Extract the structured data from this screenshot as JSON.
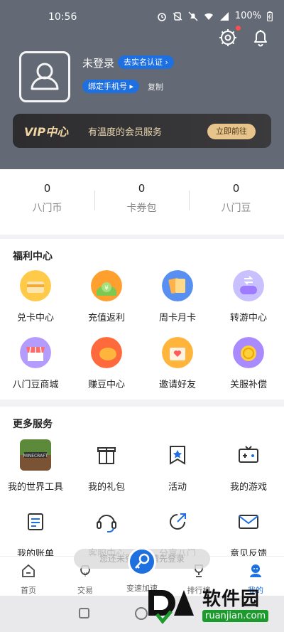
{
  "status_bar": {
    "time": "10:56",
    "battery": "100%"
  },
  "profile": {
    "username": "未登录",
    "verify_label": "去实名认证",
    "bind_phone_label": "绑定手机号",
    "copy_label": "复制"
  },
  "vip": {
    "title": "VIP中心",
    "subtitle": "有温度的会员服务",
    "button": "立即前往"
  },
  "stats": [
    {
      "value": "0",
      "label": "八门币"
    },
    {
      "value": "0",
      "label": "卡券包"
    },
    {
      "value": "0",
      "label": "八门豆"
    }
  ],
  "welfare": {
    "title": "福利中心",
    "items": [
      {
        "label": "兑卡中心",
        "icon": "card-stack-icon"
      },
      {
        "label": "充值返利",
        "icon": "money-bag-icon"
      },
      {
        "label": "周卡月卡",
        "icon": "cards-icon"
      },
      {
        "label": "转游中心",
        "icon": "gamepad-transfer-icon"
      },
      {
        "label": "八门豆商城",
        "icon": "shop-icon"
      },
      {
        "label": "赚豆中心",
        "icon": "bean-icon"
      },
      {
        "label": "邀请好友",
        "icon": "invite-envelope-icon"
      },
      {
        "label": "关服补偿",
        "icon": "coin-icon"
      }
    ]
  },
  "services": {
    "title": "更多服务",
    "items": [
      {
        "label": "我的世界工具",
        "icon": "minecraft-icon"
      },
      {
        "label": "我的礼包",
        "icon": "gift-icon"
      },
      {
        "label": "活动",
        "icon": "star-flag-icon"
      },
      {
        "label": "我的游戏",
        "icon": "game-console-icon"
      },
      {
        "label": "我的账单",
        "icon": "bill-icon"
      },
      {
        "label": "客服中心",
        "icon": "headset-icon"
      },
      {
        "label": "分享八门",
        "icon": "share-icon"
      },
      {
        "label": "意见反馈",
        "icon": "mail-icon"
      }
    ]
  },
  "toast": {
    "text": "您还未登录，请先登录"
  },
  "tabbar": [
    {
      "label": "首页",
      "icon": "home-icon"
    },
    {
      "label": "交易",
      "icon": "trade-icon"
    },
    {
      "label": "变速加速",
      "icon": "speed-icon"
    },
    {
      "label": "排行榜",
      "icon": "trophy-icon"
    },
    {
      "label": "我的",
      "icon": "user-icon"
    }
  ],
  "watermark": {
    "main": "软件园",
    "sub": "ruanjian.com"
  },
  "colors": {
    "header_bg": "#636a75",
    "accent": "#1e6fe0",
    "vip_gold": "#e6c48c"
  }
}
